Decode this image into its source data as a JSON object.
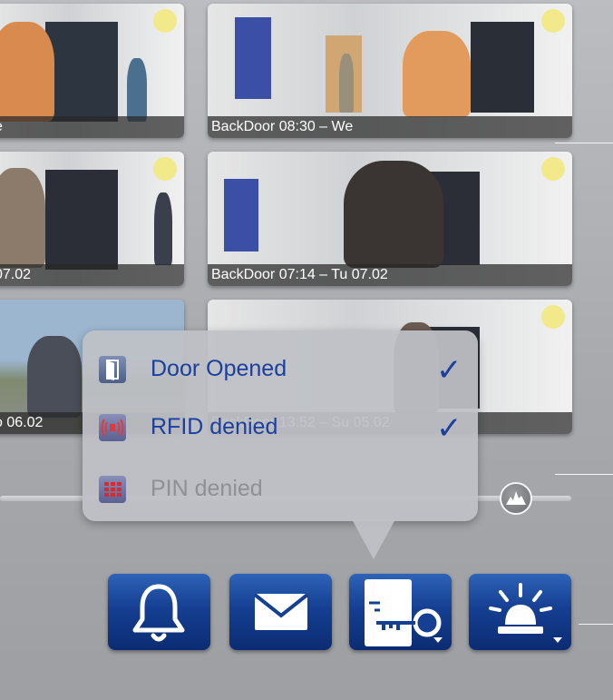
{
  "thumbnails": [
    {
      "caption": "e"
    },
    {
      "caption": "BackDoor 08:30 – We"
    },
    {
      "caption": "07.02"
    },
    {
      "caption": "BackDoor 07:14 – Tu 07.02"
    },
    {
      "caption": "o 06.02"
    },
    {
      "caption": "BackDoor 13:52 – Su 05.02"
    }
  ],
  "popup": {
    "options": [
      {
        "label": "Door Opened",
        "checked": true,
        "icon": "door-icon",
        "label_color": "#1a3f9c"
      },
      {
        "label": "RFID denied",
        "checked": true,
        "icon": "rfid-icon",
        "label_color": "#1a3f9c"
      },
      {
        "label": "PIN denied",
        "checked": false,
        "icon": "keypad-icon",
        "label_color": "#8e9095"
      }
    ],
    "check_glyph": "✓"
  },
  "toolbar": {
    "buttons": [
      {
        "icon": "bell-icon"
      },
      {
        "icon": "envelope-icon"
      },
      {
        "icon": "door-key-icon",
        "has_dropdown": true
      },
      {
        "icon": "alarm-light-icon",
        "has_dropdown": true
      }
    ]
  },
  "colors": {
    "accent": "#153f92",
    "popup_bg": "#bec1c6",
    "check": "#1a3f9c"
  }
}
